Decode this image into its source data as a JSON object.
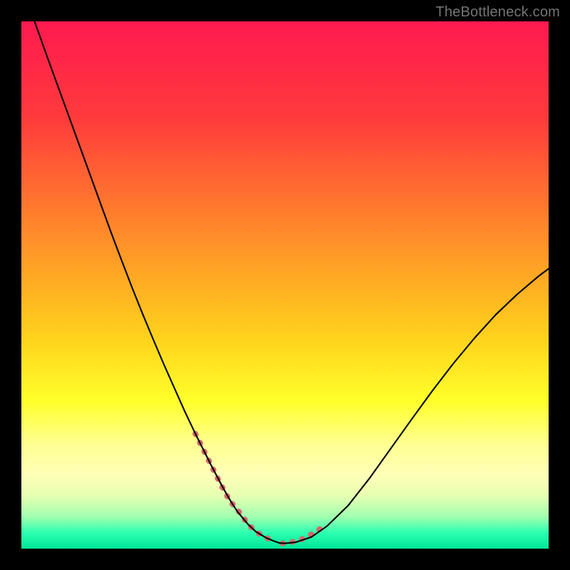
{
  "watermark": "TheBottleneck.com",
  "chart_data": {
    "type": "line",
    "title": "",
    "xlabel": "",
    "ylabel": "",
    "xlim": [
      0,
      100
    ],
    "ylim": [
      0,
      100
    ],
    "gradient_stops": [
      {
        "offset": 0,
        "color": "#ff1a50"
      },
      {
        "offset": 18,
        "color": "#ff3a3c"
      },
      {
        "offset": 40,
        "color": "#ff8a2a"
      },
      {
        "offset": 60,
        "color": "#ffd21c"
      },
      {
        "offset": 72,
        "color": "#ffff2a"
      },
      {
        "offset": 80,
        "color": "#ffff90"
      },
      {
        "offset": 86,
        "color": "#ffffb8"
      },
      {
        "offset": 90,
        "color": "#e6ffb0"
      },
      {
        "offset": 94,
        "color": "#a0ffb0"
      },
      {
        "offset": 97,
        "color": "#2cffb0"
      },
      {
        "offset": 100,
        "color": "#00e69a"
      }
    ],
    "series": [
      {
        "name": "curve",
        "stroke": "#000000",
        "stroke_width": 2.1,
        "x": [
          2.5,
          5,
          7,
          9,
          11,
          13,
          15,
          17,
          19,
          21,
          23,
          25,
          27,
          29,
          31,
          33,
          35,
          36,
          37,
          38,
          39,
          40,
          41,
          43,
          44.5,
          46.5,
          48,
          49,
          50,
          52,
          55,
          58,
          62,
          66,
          70,
          74,
          78,
          82,
          86,
          90,
          94,
          98,
          100
        ],
        "y": [
          100,
          93,
          87.5,
          82,
          76.5,
          71,
          65.5,
          60,
          54.7,
          49.5,
          44.5,
          39.7,
          35,
          30.5,
          26,
          21.8,
          17.8,
          15.8,
          13.9,
          12,
          10.2,
          8.5,
          7,
          4.6,
          3.2,
          2,
          1.4,
          1.05,
          1.0,
          1.2,
          2.2,
          4.3,
          8.2,
          13.3,
          18.9,
          24.5,
          30.0,
          35.2,
          40.0,
          44.4,
          48.2,
          51.6,
          53.1
        ]
      }
    ],
    "annotations": [
      {
        "name": "highlight-left-descent",
        "stroke": "#d46a6a",
        "stroke_width": 8,
        "x": [
          33.0,
          34.2,
          35.4,
          36.6,
          37.8,
          39.0,
          40.0
        ],
        "y": [
          21.8,
          19.4,
          17.0,
          14.6,
          12.2,
          10.0,
          8.5
        ]
      },
      {
        "name": "highlight-valley-left",
        "stroke": "#d46a6a",
        "stroke_width": 8,
        "x": [
          40.0,
          41.5,
          43.0,
          44.5,
          46.0,
          47.0,
          48.0
        ],
        "y": [
          8.5,
          6.7,
          4.6,
          3.2,
          2.3,
          1.8,
          1.4
        ]
      },
      {
        "name": "highlight-valley-right",
        "stroke": "#d46a6a",
        "stroke_width": 8,
        "x": [
          49.5,
          50.5,
          51.5,
          53.0,
          54.5,
          56.0,
          57.0
        ],
        "y": [
          1.0,
          1.1,
          1.3,
          1.7,
          2.4,
          3.3,
          4.0
        ]
      }
    ]
  }
}
